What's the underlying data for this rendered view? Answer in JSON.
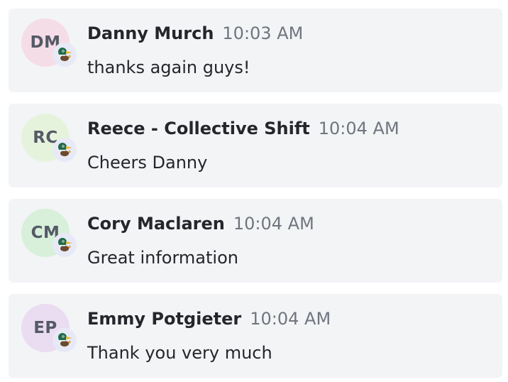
{
  "messages": [
    {
      "initials": "DM",
      "author": "Danny Murch",
      "time": "10:03 AM",
      "text": "thanks again guys!",
      "avatar_color": "#f5dde8",
      "badge_icon": "duck-icon"
    },
    {
      "initials": "RC",
      "author": "Reece - Collective Shift",
      "time": "10:04 AM",
      "text": "Cheers Danny",
      "avatar_color": "#e6f3dc",
      "badge_icon": "duck-icon"
    },
    {
      "initials": "CM",
      "author": "Cory Maclaren",
      "time": "10:04 AM",
      "text": "Great information",
      "avatar_color": "#d8f0da",
      "badge_icon": "duck-icon"
    },
    {
      "initials": "EP",
      "author": "Emmy Potgieter",
      "time": "10:04 AM",
      "text": "Thank you very much",
      "avatar_color": "#eadcf1",
      "badge_icon": "duck-icon"
    }
  ]
}
